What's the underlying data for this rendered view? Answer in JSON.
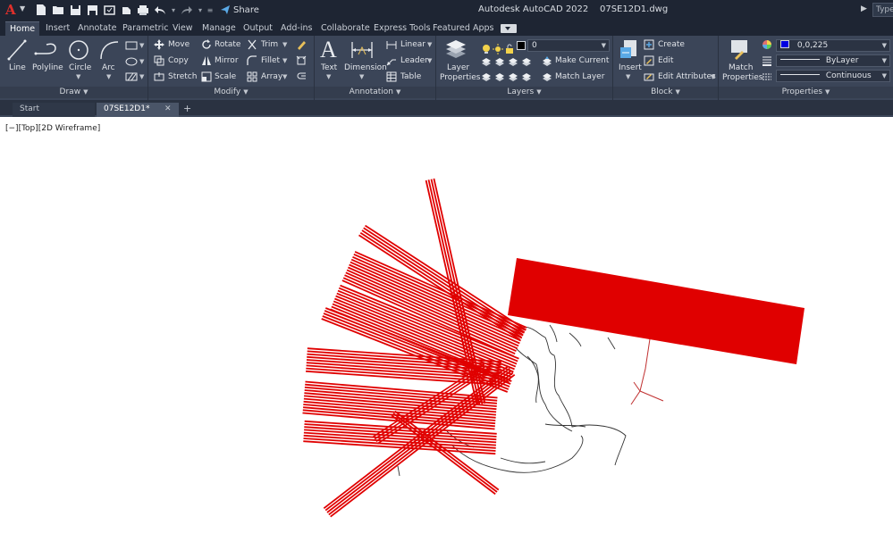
{
  "app": {
    "title": "Autodesk AutoCAD 2022    07SE12D1.dwg",
    "search_placeholder": "Type",
    "share_label": "Share"
  },
  "ribbon_tabs": [
    "Home",
    "Insert",
    "Annotate",
    "Parametric",
    "View",
    "Manage",
    "Output",
    "Add-ins",
    "Collaborate",
    "Express Tools",
    "Featured Apps"
  ],
  "active_tab": "Home",
  "panels": {
    "draw": {
      "title": "Draw",
      "tools": [
        "Line",
        "Polyline",
        "Circle",
        "Arc"
      ]
    },
    "modify": {
      "title": "Modify",
      "tools": [
        "Move",
        "Rotate",
        "Trim",
        "Copy",
        "Mirror",
        "Fillet",
        "Stretch",
        "Scale",
        "Array"
      ]
    },
    "annotation": {
      "title": "Annotation",
      "tools": [
        "Text",
        "Dimension",
        "Linear",
        "Leader",
        "Table"
      ]
    },
    "layers": {
      "title": "Layers",
      "layer_properties": "Layer Properties",
      "current_layer": "0",
      "make_current": "Make Current",
      "match_layer": "Match Layer"
    },
    "block": {
      "title": "Block",
      "insert": "Insert",
      "create": "Create",
      "edit": "Edit",
      "edit_attributes": "Edit Attributes"
    },
    "properties": {
      "title": "Properties",
      "match_properties": "Match Properties",
      "color_value": "0,0,225",
      "lineweight": "ByLayer",
      "linetype": "Continuous"
    }
  },
  "doc_tabs": [
    "Start",
    "07SE12D1*"
  ],
  "viewport": {
    "label": "[−][Top][2D Wireframe]"
  },
  "colors": {
    "accent_red": "#e00000",
    "ribbon_bg": "#3b4558",
    "title_bg": "#1e2533",
    "true_color_blue": "#0000e1"
  }
}
